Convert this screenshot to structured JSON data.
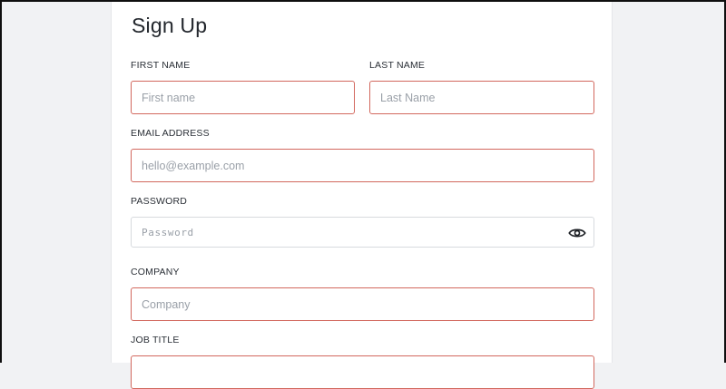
{
  "form": {
    "title": "Sign Up",
    "first_name": {
      "label": "FIRST NAME",
      "placeholder": "First name"
    },
    "last_name": {
      "label": "LAST NAME",
      "placeholder": "Last Name"
    },
    "email": {
      "label": "EMAIL ADDRESS",
      "placeholder": "hello@example.com"
    },
    "password": {
      "label": "PASSWORD",
      "placeholder": "Password",
      "toggle_icon": "eye-icon"
    },
    "company": {
      "label": "COMPANY",
      "placeholder": "Company"
    },
    "job_title": {
      "label": "JOB TITLE"
    }
  },
  "colors": {
    "page_background": "#f1f2f4",
    "card_background": "#ffffff",
    "error_border": "#d2685e",
    "neutral_border": "#d7dade",
    "placeholder": "#9aa0a8"
  }
}
